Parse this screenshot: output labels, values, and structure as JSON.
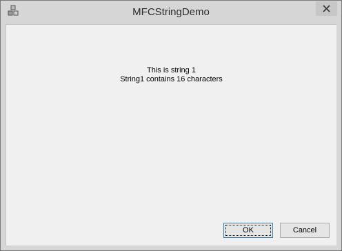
{
  "window": {
    "title": "MFCStringDemo",
    "icon": "mfc-app-icon",
    "close_icon": "close-icon"
  },
  "content": {
    "line1": "This is string 1",
    "line2": "String1 contains 16 characters"
  },
  "buttons": {
    "ok_label": "OK",
    "cancel_label": "Cancel"
  },
  "colors": {
    "frame": "#d6d6d6",
    "client": "#f0f0f0",
    "ok_border": "#3c7fb1"
  }
}
